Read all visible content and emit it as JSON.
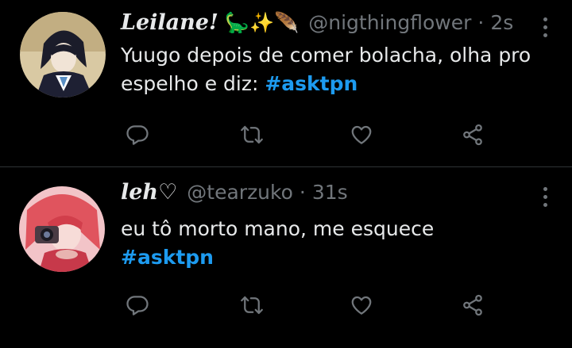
{
  "tweets": [
    {
      "name": "Leilane!",
      "emojis": "🦕✨🪶",
      "handle": "@nigthingflower",
      "separator": "·",
      "time": "2s",
      "text": "Yuugo depois de comer bolacha, olha pro espelho e diz: ",
      "hashtag": "#asktpn"
    },
    {
      "name": "leh♡",
      "emojis": "",
      "handle": "@tearzuko",
      "separator": "·",
      "time": "31s",
      "text": "eu tô morto mano, me esquece ",
      "hashtag": "#asktpn"
    }
  ],
  "colors": {
    "background": "#000000",
    "text": "#e7e9ea",
    "secondary": "#71767b",
    "hashtag": "#1d9bf0"
  },
  "icons": [
    "reply-icon",
    "retweet-icon",
    "like-icon",
    "share-icon",
    "more-icon"
  ]
}
